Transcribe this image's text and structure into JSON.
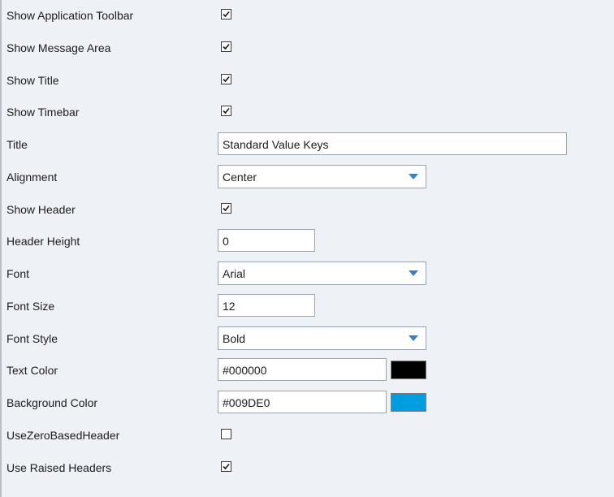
{
  "properties": {
    "show_app_toolbar": {
      "label": "Show Application Toolbar",
      "checked": true
    },
    "show_message_area": {
      "label": "Show Message Area",
      "checked": true
    },
    "show_title": {
      "label": "Show Title",
      "checked": true
    },
    "show_timebar": {
      "label": "Show Timebar",
      "checked": true
    },
    "title": {
      "label": "Title",
      "value": "Standard Value Keys"
    },
    "alignment": {
      "label": "Alignment",
      "value": "Center"
    },
    "show_header": {
      "label": "Show Header",
      "checked": true
    },
    "header_height": {
      "label": "Header Height",
      "value": "0"
    },
    "font": {
      "label": "Font",
      "value": "Arial"
    },
    "font_size": {
      "label": "Font Size",
      "value": "12"
    },
    "font_style": {
      "label": "Font Style",
      "value": "Bold"
    },
    "text_color": {
      "label": "Text Color",
      "value": "#000000",
      "swatch": "#000000"
    },
    "background_color": {
      "label": "Background Color",
      "value": "#009DE0",
      "swatch": "#009DE0"
    },
    "use_zero_based_header": {
      "label": "UseZeroBasedHeader",
      "checked": false
    },
    "use_raised_headers": {
      "label": "Use Raised Headers",
      "checked": true
    }
  },
  "colors": {
    "combo_arrow": "#3b7fc4",
    "panel_background": "#eef1f6"
  }
}
